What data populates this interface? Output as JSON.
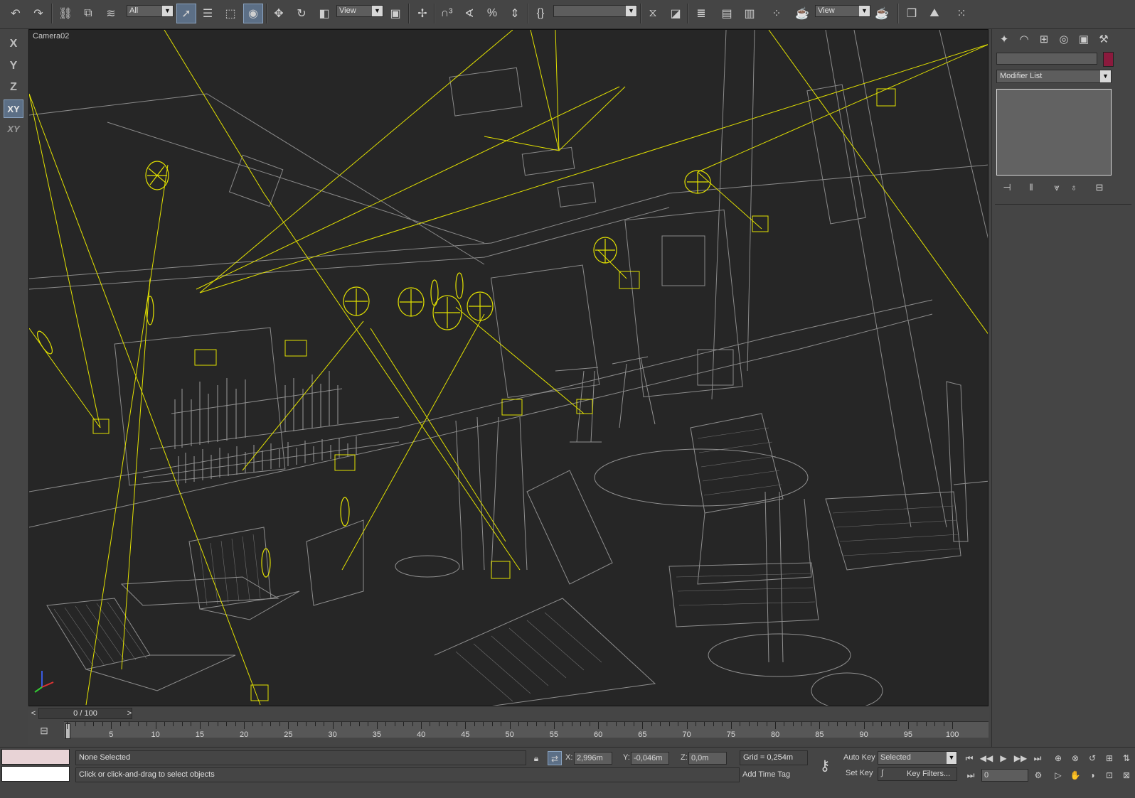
{
  "toolbar": {
    "selection_filter": "All",
    "ref_coord_1": "View",
    "named_selection": "",
    "ref_coord_2": "View"
  },
  "axis": {
    "x": "X",
    "y": "Y",
    "z": "Z",
    "xy": "XY",
    "xyz": "XY"
  },
  "viewport": {
    "label": "Camera02"
  },
  "command_panel": {
    "object_name": "",
    "modifier_list": "Modifier List",
    "accent_color": "#8b1a3d"
  },
  "time_slider": {
    "frame_display": "0 / 100",
    "prev": "<",
    "next": ">"
  },
  "track_bar": {
    "labels": [
      "5",
      "10",
      "15",
      "20",
      "25",
      "30",
      "35",
      "40",
      "45",
      "50",
      "55",
      "60",
      "65",
      "70",
      "75",
      "80",
      "85",
      "90",
      "95",
      "100"
    ]
  },
  "status": {
    "selection": "None Selected",
    "prompt": "Click or click-and-drag to select objects",
    "x_label": "X:",
    "x_value": "2,996m",
    "y_label": "Y:",
    "y_value": "-0,046m",
    "z_label": "Z:",
    "z_value": "0,0m",
    "grid": "Grid = 0,254m",
    "add_time_tag": "Add Time Tag",
    "auto_key": "Auto Key",
    "key_mode": "Selected",
    "set_key": "Set Key",
    "key_filters": "Key Filters...",
    "current_frame": "0"
  }
}
